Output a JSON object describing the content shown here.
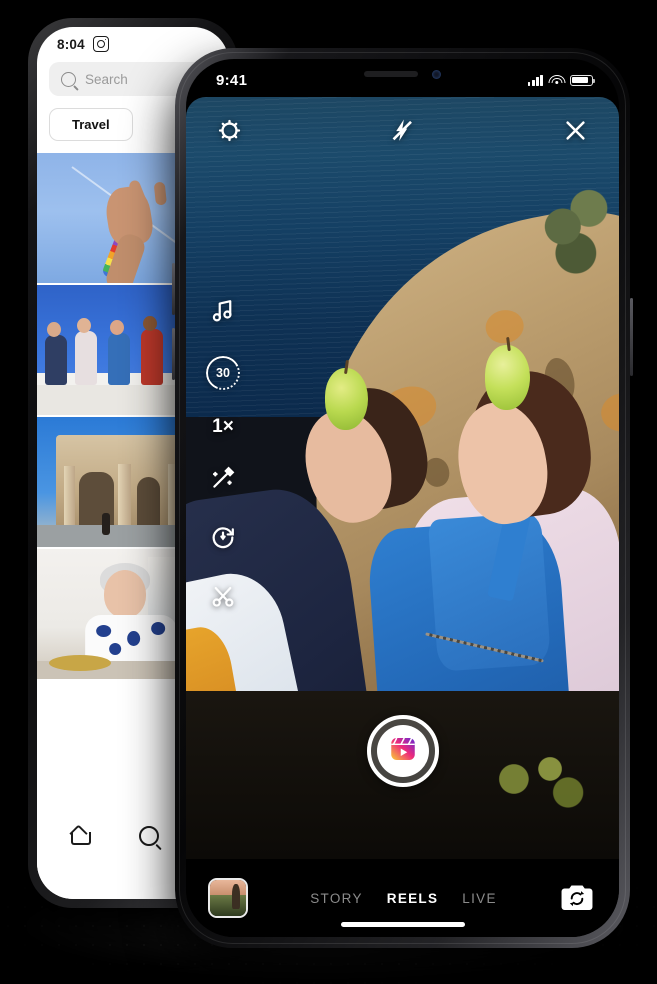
{
  "back_phone": {
    "status": {
      "time": "8:04",
      "app_glyph": "instagram-camera-icon"
    },
    "search": {
      "placeholder": "Search",
      "value": "",
      "icon": "search-icon"
    },
    "chips": [
      {
        "label": "Travel"
      }
    ],
    "grid": [
      {
        "alt": "hand-with-rainbow-jewelry",
        "has_multi": true
      },
      {
        "alt": "group-of-friends-on-wall",
        "has_multi": false
      },
      {
        "alt": "roman-triumphal-arch",
        "has_multi": false
      },
      {
        "alt": "woman-eating-at-window",
        "has_multi": false
      }
    ],
    "nav": [
      {
        "name": "home",
        "icon": "home-icon"
      },
      {
        "name": "search",
        "icon": "search-icon"
      }
    ],
    "system_nav": {
      "back": "back-triangle-icon"
    }
  },
  "front_phone": {
    "status": {
      "time": "9:41",
      "cellular": "cellular-bars-icon",
      "wifi": "wifi-icon",
      "battery": "battery-icon",
      "battery_level": "86"
    },
    "camera_top": [
      {
        "name": "settings",
        "icon": "gear-icon",
        "label": ""
      },
      {
        "name": "flash",
        "icon": "flash-off-icon",
        "label": ""
      },
      {
        "name": "close",
        "icon": "close-x-icon",
        "label": ""
      }
    ],
    "tool_rail": [
      {
        "name": "audio",
        "icon": "music-note-icon",
        "label": ""
      },
      {
        "name": "duration",
        "icon": "duration-ring-icon",
        "label": "30"
      },
      {
        "name": "speed",
        "icon": "speed-icon",
        "label": "1×"
      },
      {
        "name": "effects",
        "icon": "magic-wand-icon",
        "label": ""
      },
      {
        "name": "timer",
        "icon": "timer-icon",
        "label": ""
      },
      {
        "name": "align",
        "icon": "scissors-icon",
        "label": ""
      }
    ],
    "capture": {
      "name": "record-button",
      "icon": "reels-clapper-icon"
    },
    "bottom": {
      "gallery": {
        "icon": "gallery-thumbnail",
        "label": ""
      },
      "modes": [
        {
          "label": "STORY",
          "active": false
        },
        {
          "label": "REELS",
          "active": true
        },
        {
          "label": "LIVE",
          "active": false
        }
      ],
      "flip": {
        "icon": "camera-flip-icon",
        "label": ""
      }
    },
    "scene": {
      "description": "two-people-lying-on-rock-with-apples-by-the-sea",
      "colors": {
        "sea": "#143f63",
        "rock": "#bb9d6e",
        "denim": "#2369b8",
        "apple": "#b9d94f"
      }
    }
  },
  "theme": {
    "background": "#000000",
    "accent_gradient_start": "#f9ce34",
    "accent_gradient_mid": "#ee2a7b",
    "accent_gradient_end": "#6228d7"
  }
}
